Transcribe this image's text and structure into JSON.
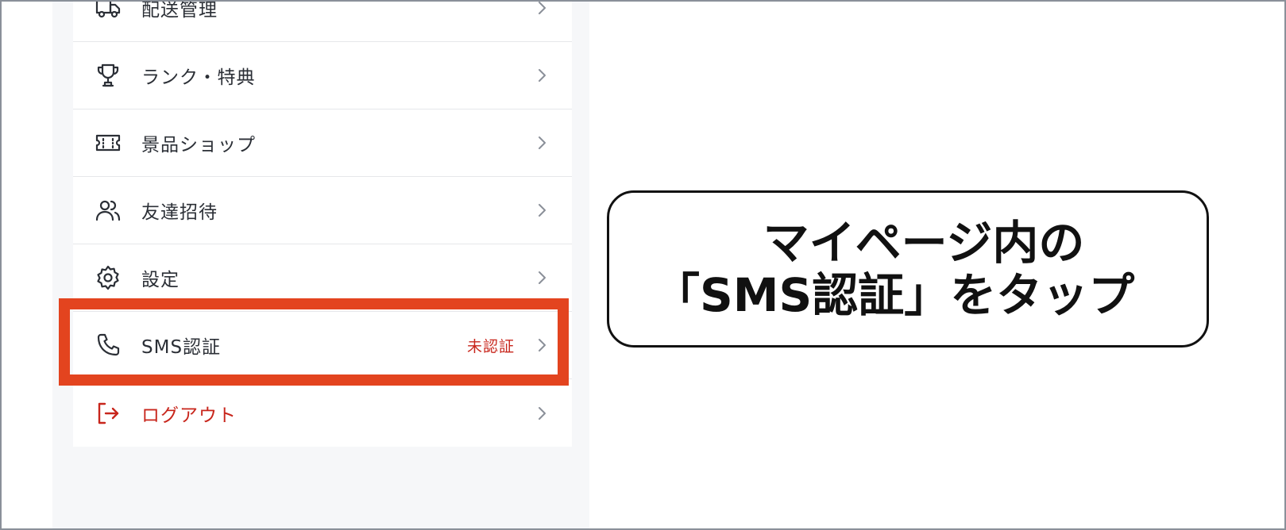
{
  "menu": {
    "items": [
      {
        "label": "配送管理",
        "icon": "truck-icon"
      },
      {
        "label": "ランク・特典",
        "icon": "trophy-icon"
      },
      {
        "label": "景品ショップ",
        "icon": "ticket-icon"
      },
      {
        "label": "友達招待",
        "icon": "users-icon"
      },
      {
        "label": "設定",
        "icon": "gear-icon"
      },
      {
        "label": "SMS認証",
        "icon": "phone-icon",
        "status": "未認証"
      },
      {
        "label": "ログアウト",
        "icon": "logout-icon"
      }
    ]
  },
  "callout": {
    "line1": "マイページ内の",
    "line2": "「SMS認証」をタップ"
  },
  "colors": {
    "highlight": "#e3441f",
    "danger": "#c8261c",
    "panel_bg": "#f6f7f9"
  }
}
